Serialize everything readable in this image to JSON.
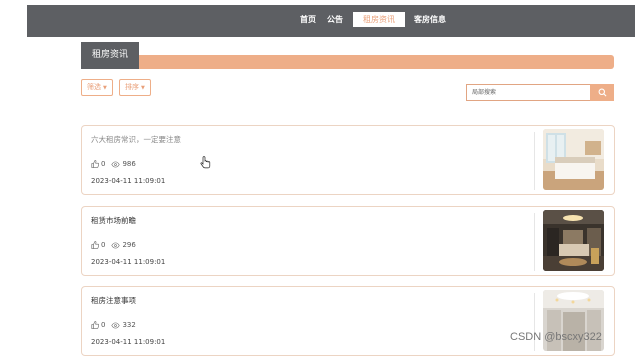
{
  "nav": {
    "items": [
      {
        "label": "首页",
        "active": false
      },
      {
        "label": "公告",
        "active": false
      },
      {
        "label": "租房资讯",
        "active": true
      },
      {
        "label": "客房信息",
        "active": false
      }
    ]
  },
  "section": {
    "title": "租房资讯"
  },
  "toolbar": {
    "filter_label": "筛选",
    "sort_label": "排序",
    "search_placeholder": "局部搜索"
  },
  "articles": [
    {
      "title": "六大租房常识，一定要注意",
      "likes": "0",
      "views": "986",
      "date": "2023-04-11 11:09:01"
    },
    {
      "title": "租赁市场前瞻",
      "likes": "0",
      "views": "296",
      "date": "2023-04-11 11:09:01"
    },
    {
      "title": "租房注意事项",
      "likes": "0",
      "views": "332",
      "date": "2023-04-11 11:09:01"
    }
  ],
  "watermark": "CSDN @bscxy322",
  "colors": {
    "accent": "#eeae88",
    "header": "#5d5f63"
  }
}
